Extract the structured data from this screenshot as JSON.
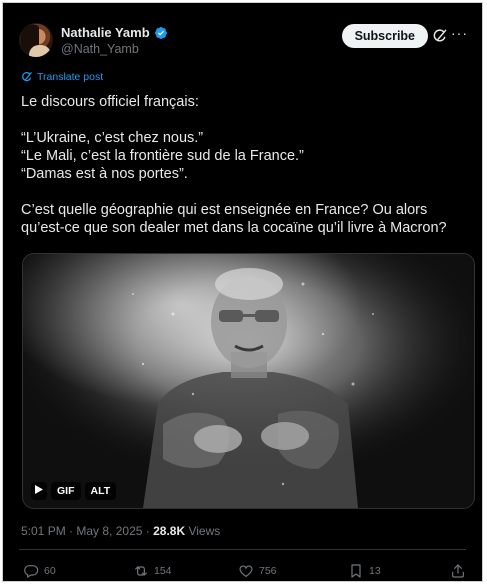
{
  "author": {
    "name": "Nathalie Yamb",
    "handle": "@Nath_Yamb"
  },
  "header": {
    "subscribe_label": "Subscribe",
    "more_label": "···"
  },
  "translate_label": "Translate post",
  "post_lines": [
    "Le discours officiel français:",
    "“L’Ukraine, c’est chez nous.”",
    "“Le Mali, c’est la frontière sud de la France.”",
    "“Damas est à nos portes”.",
    "C’est quelle géographie qui est enseignée en France? Ou alors qu’est-ce que son dealer met dans la cocaïne qu’il livre à Macron?"
  ],
  "media": {
    "gif_label": "GIF",
    "alt_label": "ALT",
    "play_icon": "play-icon"
  },
  "meta": {
    "time": "5:01 PM",
    "sep1": " · ",
    "date": "May 8, 2025",
    "sep2": " · ",
    "views_count": "28.8K",
    "views_label": "Views"
  },
  "actions": {
    "replies": "60",
    "reposts": "154",
    "likes": "756",
    "bookmarks": "13"
  },
  "colors": {
    "background": "#000000",
    "text": "#e7e9ea",
    "secondary": "#71767b",
    "accent": "#1d9bf0"
  }
}
